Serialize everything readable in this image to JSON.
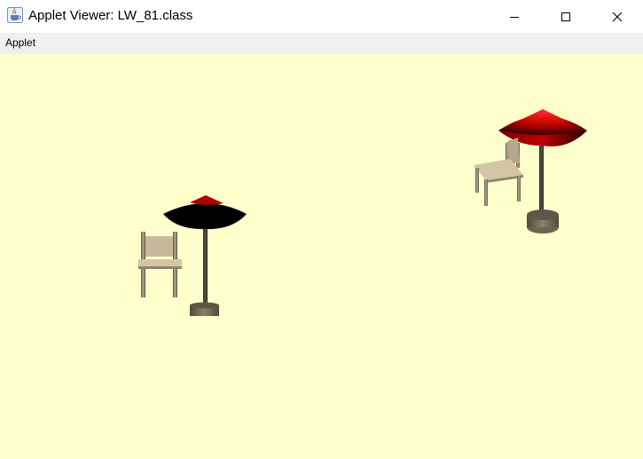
{
  "window": {
    "title": "Applet Viewer: LW_81.class",
    "app_icon": "java-cup-icon",
    "controls": {
      "minimize_icon": "minimize-icon",
      "maximize_icon": "maximize-icon",
      "close_icon": "close-icon"
    }
  },
  "menubar": {
    "items": [
      {
        "label": "Applet"
      }
    ]
  },
  "canvas": {
    "background": "#ffffcc",
    "scene": {
      "objects": [
        {
          "kind": "umbrella",
          "canopy_color": "#c00000"
        },
        {
          "kind": "chair",
          "seat_color": "#c8b99a"
        },
        {
          "kind": "umbrella",
          "canopy_color": "#c00000"
        },
        {
          "kind": "chair",
          "seat_color": "#c8b99a"
        }
      ]
    }
  }
}
